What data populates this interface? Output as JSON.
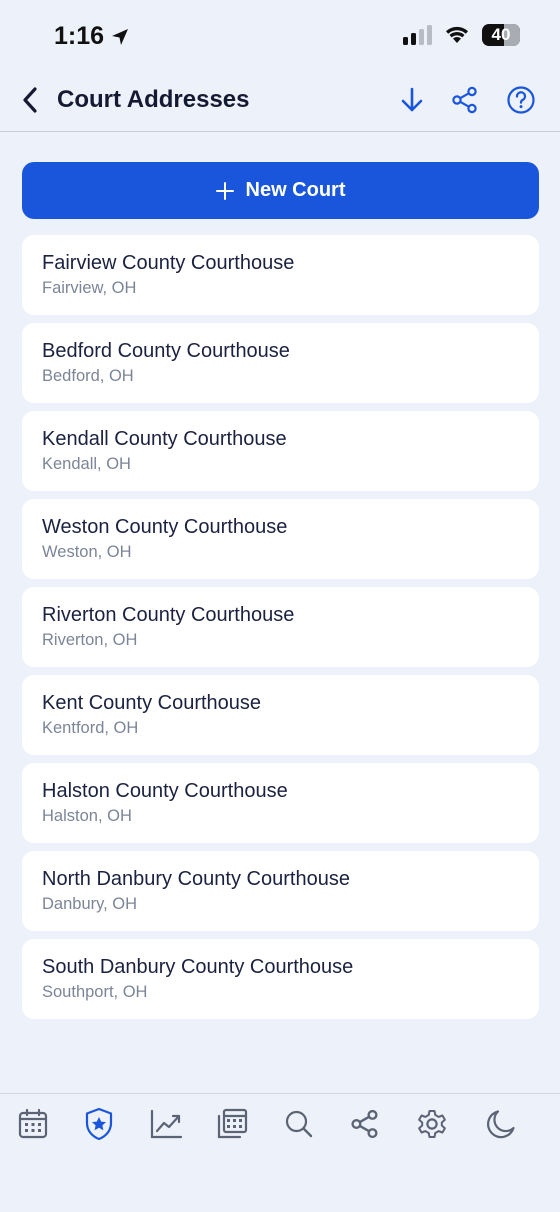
{
  "status_bar": {
    "time": "1:16",
    "battery": "40"
  },
  "nav": {
    "title": "Court Addresses"
  },
  "new_court_button": {
    "label": "New Court"
  },
  "courts": [
    {
      "name": "Fairview County Courthouse",
      "city": "Fairview, OH"
    },
    {
      "name": "Bedford County Courthouse",
      "city": "Bedford, OH"
    },
    {
      "name": "Kendall County Courthouse",
      "city": "Kendall, OH"
    },
    {
      "name": "Weston County Courthouse",
      "city": "Weston, OH"
    },
    {
      "name": "Riverton County Courthouse",
      "city": "Riverton, OH"
    },
    {
      "name": "Kent County Courthouse",
      "city": "Kentford, OH"
    },
    {
      "name": "Halston County Courthouse",
      "city": "Halston, OH"
    },
    {
      "name": "North Danbury County Courthouse",
      "city": "Danbury, OH"
    },
    {
      "name": "South Danbury County Courthouse",
      "city": "Southport, OH"
    }
  ],
  "tabs": [
    {
      "icon": "calendar-icon",
      "active": false
    },
    {
      "icon": "shield-star-icon",
      "active": true
    },
    {
      "icon": "chart-trend-icon",
      "active": false
    },
    {
      "icon": "calendar-stack-icon",
      "active": false
    },
    {
      "icon": "search-icon",
      "active": false
    },
    {
      "icon": "share-icon",
      "active": false
    },
    {
      "icon": "gear-icon",
      "active": false
    },
    {
      "icon": "moon-icon",
      "active": false
    }
  ],
  "colors": {
    "accent": "#1a56db",
    "background": "#edf1f9",
    "card": "#ffffff",
    "tab_icon": "#5b6475"
  }
}
